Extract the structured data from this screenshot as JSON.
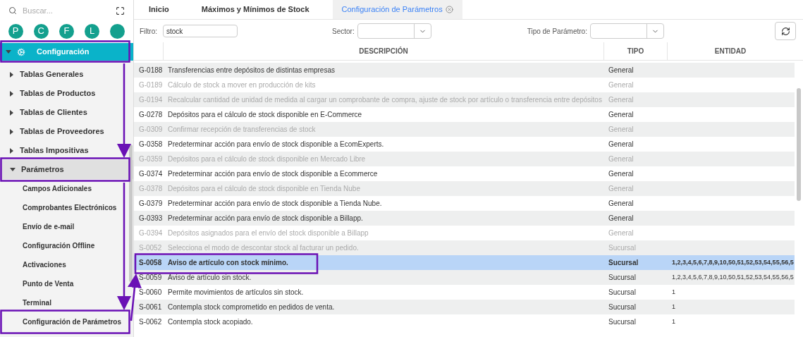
{
  "sidebar": {
    "search": {
      "placeholder": "Buscar..."
    },
    "shortcuts": [
      {
        "label": "P"
      },
      {
        "label": "C"
      },
      {
        "label": "F"
      },
      {
        "label": "L"
      }
    ],
    "section": {
      "label": "Configuración",
      "expanded": true
    },
    "items": [
      {
        "label": "Tablas Generales",
        "expanded": false,
        "selected": false
      },
      {
        "label": "Tablas de Productos",
        "expanded": false,
        "selected": false
      },
      {
        "label": "Tablas de Clientes",
        "expanded": false,
        "selected": false
      },
      {
        "label": "Tablas de Proveedores",
        "expanded": false,
        "selected": false
      },
      {
        "label": "Tablas Impositivas",
        "expanded": false,
        "selected": false
      },
      {
        "label": "Parámetros",
        "expanded": true,
        "selected": true,
        "children": [
          {
            "label": "Campos Adicionales"
          },
          {
            "label": "Comprobantes Electrónicos"
          },
          {
            "label": "Envío de e-mail"
          },
          {
            "label": "Configuración Offline"
          },
          {
            "label": "Activaciones"
          },
          {
            "label": "Punto de Venta"
          },
          {
            "label": "Terminal"
          },
          {
            "label": "Configuración de Parámetros"
          }
        ]
      }
    ]
  },
  "tabs": [
    {
      "label": "Inicio",
      "selected": false,
      "closable": false
    },
    {
      "label": "Máximos y Mínimos de Stock",
      "selected": false,
      "closable": false
    },
    {
      "label": "Configuración de Parámetros",
      "selected": true,
      "closable": true
    }
  ],
  "filters": {
    "filter_label": "Filtro:",
    "filter_value": "stock",
    "sector_label": "Sector:",
    "type_label": "Tipo de Parámetro:"
  },
  "table": {
    "columns": [
      "DESCRIPCIÓN",
      "TIPO",
      "ENTIDAD"
    ],
    "rows": [
      {
        "code": "G-0188",
        "description": "Transferencias entre depósitos de distintas empresas",
        "type": "General",
        "enabled": true,
        "selected": false
      },
      {
        "code": "G-0189",
        "description": "Cálculo de stock a mover en producción de kits",
        "type": "General",
        "enabled": false,
        "selected": false
      },
      {
        "code": "G-0194",
        "description": "Recalcular cantidad de unidad de medida al cargar un comprobante de compra, ajuste de stock por artículo o transferencia entre depósitos",
        "type": "General",
        "enabled": false,
        "selected": false
      },
      {
        "code": "G-0278",
        "description": "Depósitos para el cálculo de stock disponible en E-Commerce",
        "type": "General",
        "enabled": true,
        "selected": false
      },
      {
        "code": "G-0309",
        "description": "Confirmar recepción de transferencias de stock",
        "type": "General",
        "enabled": false,
        "selected": false
      },
      {
        "code": "G-0358",
        "description": "Predeterminar acción para envío de stock disponible a EcomExperts.",
        "type": "General",
        "enabled": true,
        "selected": false
      },
      {
        "code": "G-0359",
        "description": "Depósitos para el cálculo de stock disponible en Mercado Libre",
        "type": "General",
        "enabled": false,
        "selected": false
      },
      {
        "code": "G-0374",
        "description": "Predeterminar acción para envío de stock disponible a Ecommerce",
        "type": "General",
        "enabled": true,
        "selected": false
      },
      {
        "code": "G-0378",
        "description": "Depósitos para el cálculo de stock disponible en Tienda Nube",
        "type": "General",
        "enabled": false,
        "selected": false
      },
      {
        "code": "G-0379",
        "description": "Predeterminar acción para envío de stock disponible a Tienda Nube.",
        "type": "General",
        "enabled": true,
        "selected": false
      },
      {
        "code": "G-0393",
        "description": "Predeterminar acción para envío de stock disponible a Billapp.",
        "type": "General",
        "enabled": true,
        "selected": false
      },
      {
        "code": "G-0394",
        "description": "Depósitos asignados para el envío del stock disponible a Billapp",
        "type": "General",
        "enabled": false,
        "selected": false
      },
      {
        "code": "S-0052",
        "description": "Selecciona el modo de descontar stock al facturar un pedido.",
        "type": "Sucursal",
        "enabled": false,
        "selected": false
      },
      {
        "code": "S-0058",
        "description": "Aviso de artículo con stock mínimo.",
        "type": "Sucursal",
        "entity": "1,2,3,4,5,6,7,8,9,10,50,51,52,53,54,55,56,5",
        "enabled": true,
        "selected": true
      },
      {
        "code": "S-0059",
        "description": "Aviso de artículo sin stock.",
        "type": "Sucursal",
        "entity": "1,2,3,4,5,6,7,8,9,10,50,51,52,53,54,55,56,5",
        "enabled": true,
        "selected": false
      },
      {
        "code": "S-0060",
        "description": "Permite movimientos de artículos sin stock.",
        "type": "Sucursal",
        "entity": "1",
        "enabled": true,
        "selected": false
      },
      {
        "code": "S-0061",
        "description": "Contempla stock comprometido en pedidos de venta.",
        "type": "Sucursal",
        "entity": "1",
        "enabled": true,
        "selected": false
      },
      {
        "code": "S-0062",
        "description": "Contempla stock acopiado.",
        "type": "Sucursal",
        "entity": "1",
        "enabled": true,
        "selected": false
      }
    ]
  }
}
